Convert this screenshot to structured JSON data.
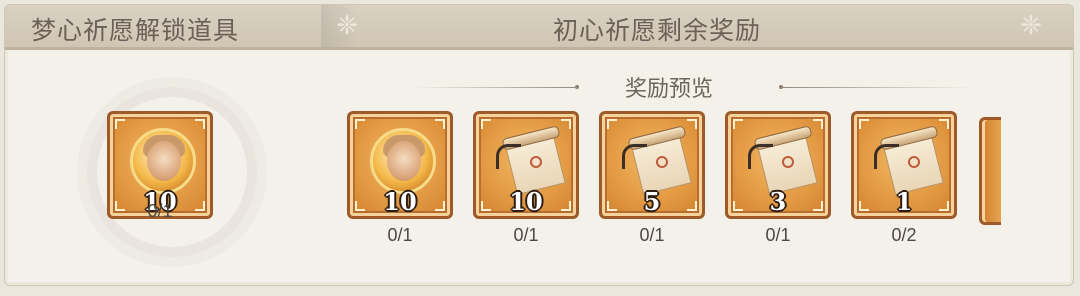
{
  "header": {
    "left_title": "梦心祈愿解锁道具",
    "right_title": "初心祈愿剩余奖励"
  },
  "preview": {
    "title": "奖励预览"
  },
  "unlock_item": {
    "icon": "character-coin-icon",
    "count": "10",
    "progress": "0/1"
  },
  "rewards": [
    {
      "icon": "character-coin-icon",
      "count": "10",
      "progress": "0/1"
    },
    {
      "icon": "scroll-icon",
      "count": "10",
      "progress": "0/1"
    },
    {
      "icon": "scroll-icon",
      "count": "5",
      "progress": "0/1"
    },
    {
      "icon": "scroll-icon",
      "count": "3",
      "progress": "0/1"
    },
    {
      "icon": "scroll-icon",
      "count": "1",
      "progress": "0/2"
    }
  ],
  "colors": {
    "frame_border": "#9e5a28",
    "frame_fill": "#e39a42",
    "header_bg": "#d3cbba",
    "text": "#6b6156"
  }
}
